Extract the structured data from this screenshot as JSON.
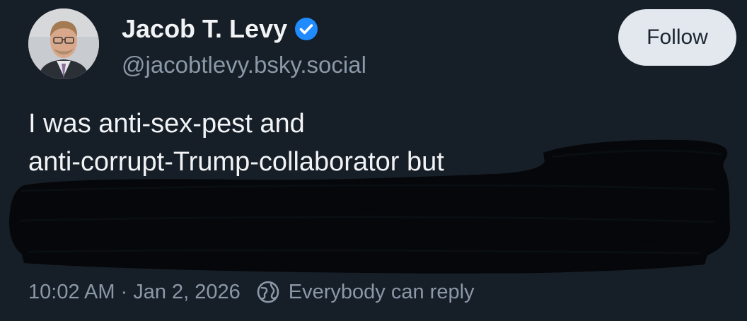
{
  "author": {
    "display_name": "Jacob T. Levy",
    "handle": "@jacobtlevy.bsky.social",
    "verified": true
  },
  "actions": {
    "follow_label": "Follow"
  },
  "post": {
    "text_line_1": "I was anti-sex-pest and",
    "text_line_2": "anti-corrupt-Trump-collaborator but"
  },
  "meta": {
    "time": "10:02 AM",
    "separator": "·",
    "date": "Jan 2, 2026",
    "reply_setting": "Everybody can reply"
  },
  "colors": {
    "background": "#161e27",
    "text_primary": "#f1f3f5",
    "text_secondary": "#8b98a7",
    "verified_badge": "#208bfe",
    "follow_button_bg": "#e3e8ee",
    "redaction": "#05070a"
  },
  "icons": {
    "verified": "verified-check-icon",
    "reply_setting": "globe-icon"
  }
}
